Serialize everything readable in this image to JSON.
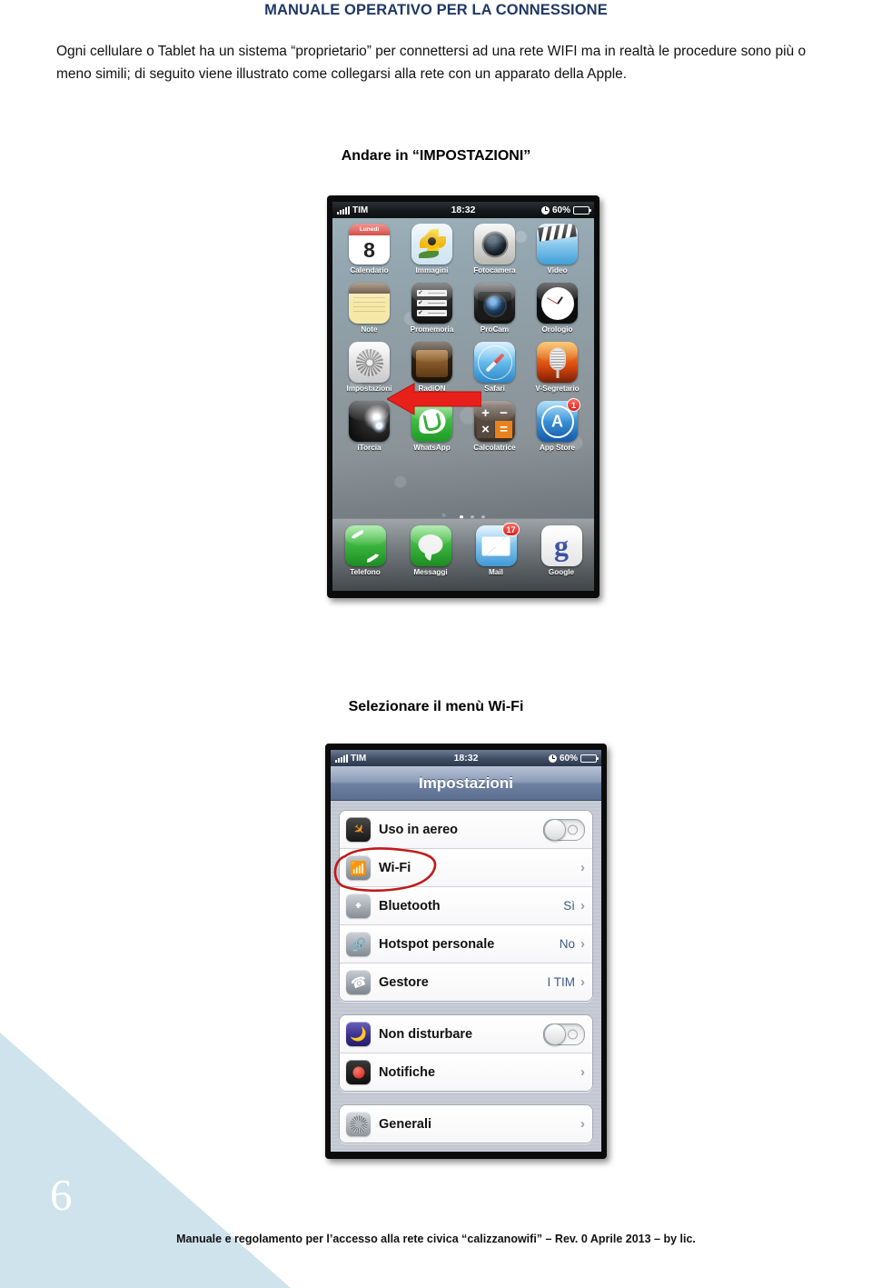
{
  "document": {
    "title": "MANUALE OPERATIVO PER LA CONNESSIONE",
    "title_color": "#1f3864",
    "intro": "Ogni cellulare o Tablet ha un sistema “proprietario” per connettersi ad una rete WIFI ma in realtà le procedure sono più o meno simili;  di seguito viene illustrato come collegarsi alla rete con un apparato della  Apple.",
    "page_number": "6",
    "footer": "Manuale e regolamento per l’accesso alla rete civica “calizzanowifi” – Rev. 0 Aprile 2013 – by lic.",
    "corner_color": "#cfe3ec"
  },
  "steps": [
    {
      "caption": "Andare in “IMPOSTAZIONI”"
    },
    {
      "caption": "Selezionare il menù Wi-Fi"
    }
  ],
  "annotations": {
    "arrow_color": "#e8201a",
    "circle_color": "#c01a1a",
    "arrow_target": "Impostazioni",
    "circle_target": "Wi-Fi"
  },
  "phone_home": {
    "statusbar": {
      "carrier": "TIM",
      "time": "18:32",
      "battery_percent": "60%",
      "battery_level": 60,
      "alarm_icon": "alarm-clock-icon",
      "signal_icon": "signal-bars-icon"
    },
    "apps": [
      {
        "label": "Calendario",
        "icon": "calendar-icon",
        "cal_weekday": "Lunedì",
        "cal_day": "8"
      },
      {
        "label": "Immagini",
        "icon": "photos-icon"
      },
      {
        "label": "Fotocamera",
        "icon": "camera-icon"
      },
      {
        "label": "Video",
        "icon": "video-icon"
      },
      {
        "label": "Note",
        "icon": "notes-icon"
      },
      {
        "label": "Promemoria",
        "icon": "reminders-icon"
      },
      {
        "label": "ProCam",
        "icon": "procam-icon"
      },
      {
        "label": "Orologio",
        "icon": "clock-icon"
      },
      {
        "label": "Impostazioni",
        "icon": "settings-gear-icon"
      },
      {
        "label": "RadiON",
        "icon": "radion-icon"
      },
      {
        "label": "Safari",
        "icon": "safari-compass-icon"
      },
      {
        "label": "V-Segretario",
        "icon": "microphone-icon"
      },
      {
        "label": "iTorcia",
        "icon": "flashlight-icon"
      },
      {
        "label": "WhatsApp",
        "icon": "whatsapp-icon"
      },
      {
        "label": "Calcolatrice",
        "icon": "calculator-icon"
      },
      {
        "label": "App Store",
        "icon": "app-store-icon",
        "badge": "1"
      }
    ],
    "page_dots": {
      "count": 4,
      "active_index": 1
    },
    "dock": [
      {
        "label": "Telefono",
        "icon": "phone-handset-icon"
      },
      {
        "label": "Messaggi",
        "icon": "message-bubble-icon"
      },
      {
        "label": "Mail",
        "icon": "mail-envelope-icon",
        "badge": "17"
      },
      {
        "label": "Google",
        "icon": "google-g-icon"
      }
    ]
  },
  "phone_settings": {
    "statusbar": {
      "carrier": "TIM",
      "time": "18:32",
      "battery_percent": "60%",
      "battery_level": 60
    },
    "navbar_title": "Impostazioni",
    "groups": [
      {
        "rows": [
          {
            "label": "Uso in aereo",
            "icon": "airplane-icon",
            "control": "toggle",
            "value": ""
          },
          {
            "label": "Wi-Fi",
            "icon": "wifi-icon",
            "control": "chevron",
            "value": ""
          },
          {
            "label": "Bluetooth",
            "icon": "bluetooth-icon",
            "control": "chevron",
            "value": "Sì"
          },
          {
            "label": "Hotspot personale",
            "icon": "hotspot-icon",
            "control": "chevron",
            "value": "No"
          },
          {
            "label": "Gestore",
            "icon": "carrier-icon",
            "control": "chevron",
            "value": "I TIM"
          }
        ]
      },
      {
        "rows": [
          {
            "label": "Non disturbare",
            "icon": "do-not-disturb-moon-icon",
            "control": "toggle",
            "value": ""
          },
          {
            "label": "Notifiche",
            "icon": "notifications-icon",
            "control": "chevron",
            "value": ""
          }
        ]
      },
      {
        "rows": [
          {
            "label": "Generali",
            "icon": "general-gear-icon",
            "control": "chevron",
            "value": ""
          }
        ]
      }
    ],
    "chevron_glyph": "›"
  }
}
